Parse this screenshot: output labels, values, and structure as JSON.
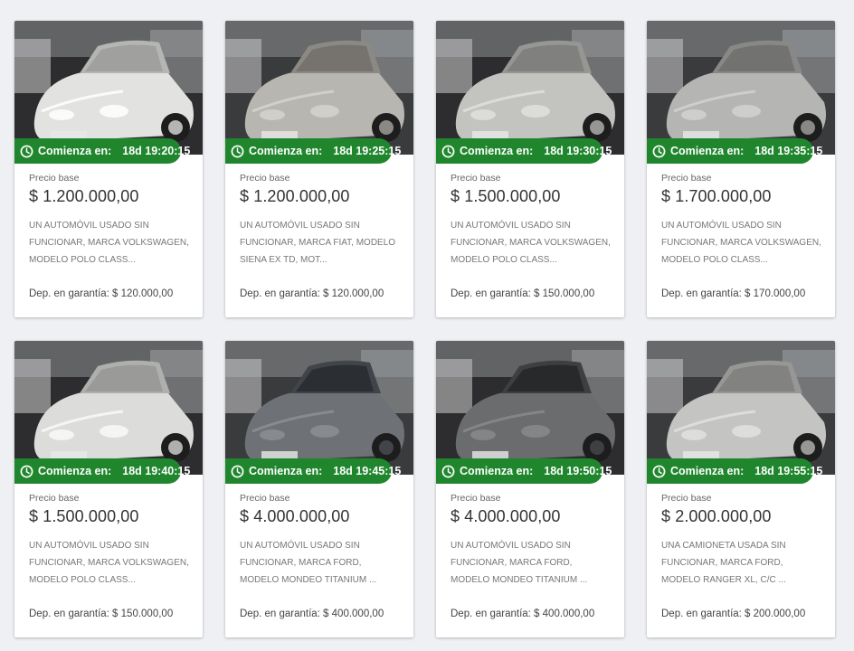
{
  "colors": {
    "timer_bg": "#20862d",
    "card_bg": "#ffffff",
    "page_bg": "#eef0f3"
  },
  "icons": {
    "timer": "clock-icon"
  },
  "lots": [
    {
      "timer_label": "Comienza en:",
      "timer_value": "18d 19:20:15",
      "base_label": "Precio base",
      "price": "$ 1.200.000,00",
      "description": "UN AUTOMÓVIL USADO SIN FUNCIONAR, MARCA VOLKSWAGEN, MODELO POLO CLASS...",
      "deposit": "Dep. en garantía: $ 120.000,00",
      "photo_color": "#e2e2e0"
    },
    {
      "timer_label": "Comienza en:",
      "timer_value": "18d 19:25:15",
      "base_label": "Precio base",
      "price": "$ 1.200.000,00",
      "description": "UN AUTOMÓVIL USADO SIN FUNCIONAR, MARCA FIAT, MODELO SIENA EX TD, MOT...",
      "deposit": "Dep. en garantía: $ 120.000,00",
      "photo_color": "#b8b6b1"
    },
    {
      "timer_label": "Comienza en:",
      "timer_value": "18d 19:30:15",
      "base_label": "Precio base",
      "price": "$ 1.500.000,00",
      "description": "UN AUTOMÓVIL USADO SIN FUNCIONAR, MARCA VOLKSWAGEN, MODELO POLO CLASS...",
      "deposit": "Dep. en garantía: $ 150.000,00",
      "photo_color": "#c3c3c0"
    },
    {
      "timer_label": "Comienza en:",
      "timer_value": "18d 19:35:15",
      "base_label": "Precio base",
      "price": "$ 1.700.000,00",
      "description": "UN AUTOMÓVIL USADO SIN FUNCIONAR, MARCA VOLKSWAGEN, MODELO POLO CLASS...",
      "deposit": "Dep. en garantía: $ 170.000,00",
      "photo_color": "#b5b5b3"
    },
    {
      "timer_label": "Comienza en:",
      "timer_value": "18d 19:40:15",
      "base_label": "Precio base",
      "price": "$ 1.500.000,00",
      "description": "UN AUTOMÓVIL USADO SIN FUNCIONAR, MARCA VOLKSWAGEN, MODELO POLO CLASS...",
      "deposit": "Dep. en garantía: $ 150.000,00",
      "photo_color": "#dcdcdb"
    },
    {
      "timer_label": "Comienza en:",
      "timer_value": "18d 19:45:15",
      "base_label": "Precio base",
      "price": "$ 4.000.000,00",
      "description": "UN AUTOMÓVIL USADO SIN FUNCIONAR, MARCA FORD, MODELO MONDEO TITANIUM ...",
      "deposit": "Dep. en garantía: $ 400.000,00",
      "photo_color": "#6e7276"
    },
    {
      "timer_label": "Comienza en:",
      "timer_value": "18d 19:50:15",
      "base_label": "Precio base",
      "price": "$ 4.000.000,00",
      "description": "UN AUTOMÓVIL USADO SIN FUNCIONAR, MARCA FORD, MODELO MONDEO TITANIUM ...",
      "deposit": "Dep. en garantía: $ 400.000,00",
      "photo_color": "#6a6c6e"
    },
    {
      "timer_label": "Comienza en:",
      "timer_value": "18d 19:55:15",
      "base_label": "Precio base",
      "price": "$ 2.000.000,00",
      "description": "UNA CAMIONETA USADA SIN FUNCIONAR, MARCA FORD, MODELO RANGER XL, C/C ...",
      "deposit": "Dep. en garantía: $ 200.000,00",
      "photo_color": "#c4c4c2"
    }
  ]
}
